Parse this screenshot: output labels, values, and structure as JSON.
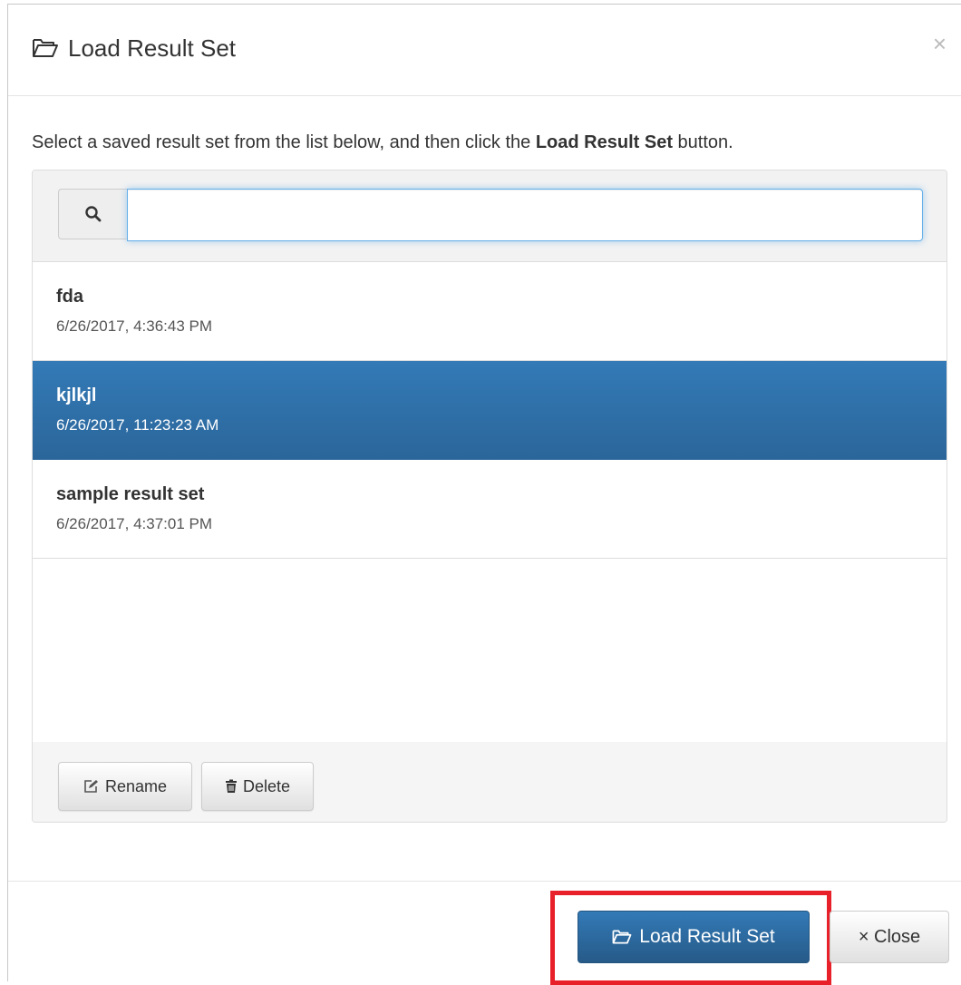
{
  "dialog": {
    "title": "Load Result Set",
    "close_glyph": "×",
    "title_icon": "folder-open-icon"
  },
  "instructions": {
    "before": "Select a saved result set from the list below, and then click the ",
    "bold": "Load Result Set",
    "after": " button."
  },
  "search": {
    "icon": "search-icon",
    "value": "",
    "placeholder": ""
  },
  "result_sets": [
    {
      "name": "fda",
      "date": "6/26/2017, 4:36:43 PM",
      "selected": false
    },
    {
      "name": "kjlkjl",
      "date": "6/26/2017, 11:23:23 AM",
      "selected": true
    },
    {
      "name": "sample result set",
      "date": "6/26/2017, 4:37:01 PM",
      "selected": false
    }
  ],
  "list_actions": {
    "rename_label": "Rename",
    "delete_label": "Delete",
    "rename_icon": "edit-icon",
    "delete_icon": "trash-icon"
  },
  "footer": {
    "load_label": "Load Result Set",
    "close_label": "× Close",
    "highlight_color": "#e8202a"
  },
  "colors": {
    "primary": "#337ab7",
    "selected_row": "#2f72ad"
  }
}
